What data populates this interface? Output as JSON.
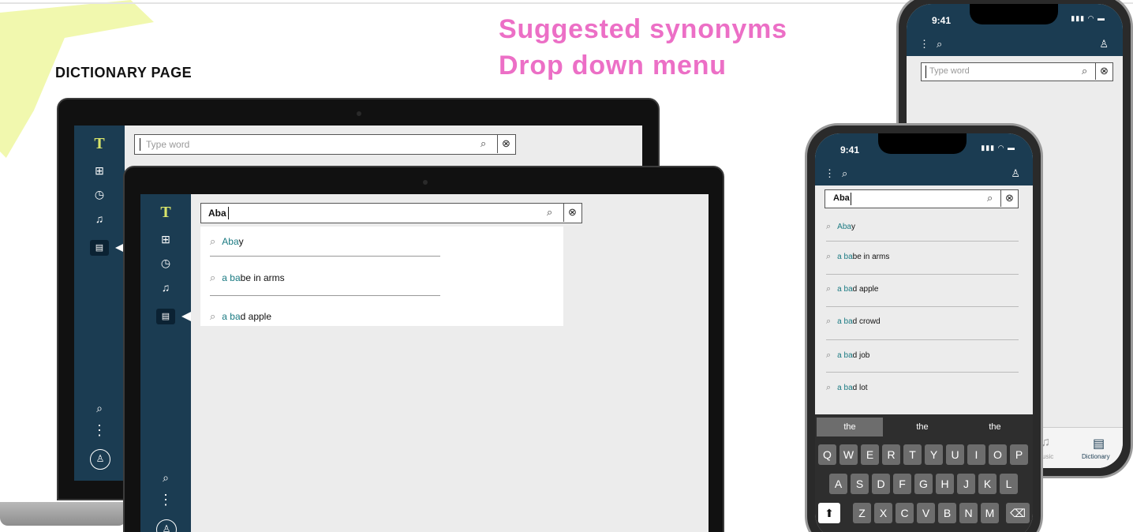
{
  "page_label": "DICTIONARY PAGE",
  "headline": [
    "Suggested synonyms",
    "Drop down menu"
  ],
  "desktop": {
    "logo": "T",
    "nav_icons": [
      "grid-icon",
      "clock-icon",
      "music-note-icon",
      "dictionary-icon"
    ],
    "search_placeholder": "Type word",
    "search_value": "Aba",
    "suggestions": [
      {
        "highlight": "Aba",
        "rest": "y"
      },
      {
        "highlight": "a ba",
        "rest": "be in arms"
      },
      {
        "highlight": "a ba",
        "rest": "d apple"
      }
    ]
  },
  "phone": {
    "time": "9:41",
    "search_placeholder": "Type word",
    "search_value": "Aba",
    "suggestions": [
      {
        "highlight": "Aba",
        "rest": "y"
      },
      {
        "highlight": "a ba",
        "rest": "be in arms"
      },
      {
        "highlight": "a ba",
        "rest": "d apple"
      },
      {
        "highlight": "a ba",
        "rest": "d crowd"
      },
      {
        "highlight": "a ba",
        "rest": "d job"
      },
      {
        "highlight": "a ba",
        "rest": "d lot"
      }
    ],
    "predictions": [
      "the",
      "the",
      "the"
    ],
    "keyboard_rows": [
      [
        "Q",
        "W",
        "E",
        "R",
        "T",
        "Y",
        "U",
        "I",
        "O",
        "P"
      ],
      [
        "A",
        "S",
        "D",
        "F",
        "G",
        "H",
        "J",
        "K",
        "L"
      ],
      [
        "Z",
        "X",
        "C",
        "V",
        "B",
        "N",
        "M"
      ]
    ],
    "tabs": {
      "music_partial": "usic",
      "dictionary": "Dictionary"
    }
  },
  "colors": {
    "headline": "#ec6fc6",
    "rail": "#1b3c52",
    "logo": "#d8e46a",
    "match": "#1a7a82"
  }
}
